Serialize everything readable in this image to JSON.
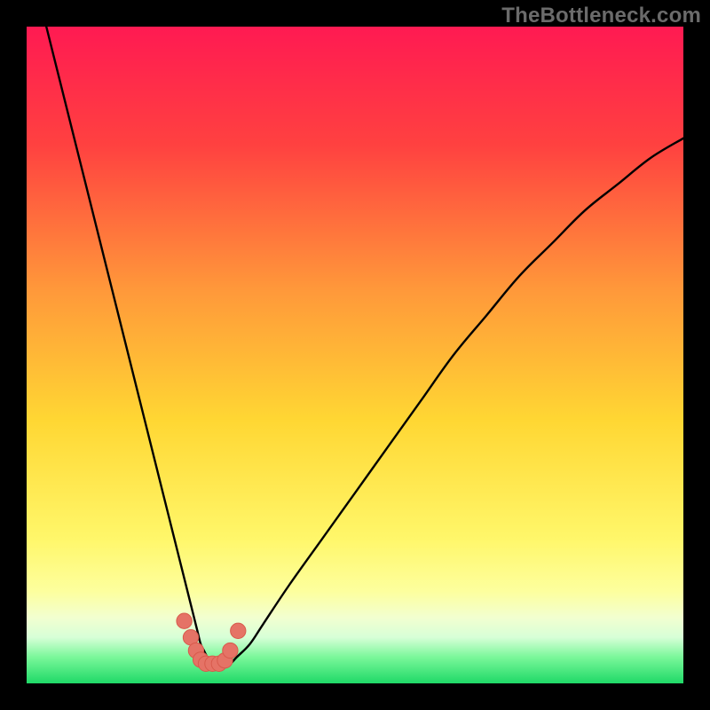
{
  "watermark": "TheBottleneck.com",
  "colors": {
    "frame": "#000000",
    "grad_top": "#ff1a52",
    "grad_mid1": "#ff7a33",
    "grad_mid2": "#ffd633",
    "grad_low": "#fffb8a",
    "grad_pale": "#f6ffe0",
    "grad_green": "#28e46d",
    "curve": "#000000",
    "marker_fill": "#e57366",
    "marker_stroke": "#d85a4c"
  },
  "chart_data": {
    "type": "line",
    "title": "",
    "xlabel": "",
    "ylabel": "",
    "xlim": [
      0,
      100
    ],
    "ylim": [
      0,
      100
    ],
    "series": [
      {
        "name": "bottleneck-curve",
        "x": [
          3,
          5,
          7,
          9,
          11,
          13,
          15,
          17,
          19,
          21,
          22,
          23,
          24,
          25,
          25.5,
          26,
          26.5,
          27,
          27.5,
          28,
          28.5,
          29,
          30,
          31,
          32,
          34,
          36,
          40,
          45,
          50,
          55,
          60,
          65,
          70,
          75,
          80,
          85,
          90,
          95,
          100
        ],
        "y": [
          100,
          92,
          84,
          76,
          68,
          60,
          52,
          44,
          36,
          28,
          24,
          20,
          16,
          12,
          10,
          8,
          6,
          5,
          4,
          3.2,
          2.8,
          2.8,
          2.8,
          3,
          4,
          6,
          9,
          15,
          22,
          29,
          36,
          43,
          50,
          56,
          62,
          67,
          72,
          76,
          80,
          83
        ]
      }
    ],
    "markers": [
      {
        "x": 24.0,
        "y": 9.5,
        "r": 1.3
      },
      {
        "x": 25.0,
        "y": 7.0,
        "r": 1.3
      },
      {
        "x": 25.8,
        "y": 5.0,
        "r": 1.3
      },
      {
        "x": 26.5,
        "y": 3.6,
        "r": 1.3
      },
      {
        "x": 27.3,
        "y": 3.0,
        "r": 1.3
      },
      {
        "x": 28.3,
        "y": 3.0,
        "r": 1.3
      },
      {
        "x": 29.3,
        "y": 3.0,
        "r": 1.3
      },
      {
        "x": 30.2,
        "y": 3.5,
        "r": 1.3
      },
      {
        "x": 31.0,
        "y": 5.0,
        "r": 1.3
      },
      {
        "x": 32.2,
        "y": 8.0,
        "r": 1.3
      }
    ],
    "gradient_stops": [
      {
        "offset": 0,
        "color": "#ff1a52"
      },
      {
        "offset": 18,
        "color": "#ff4140"
      },
      {
        "offset": 40,
        "color": "#ff983a"
      },
      {
        "offset": 60,
        "color": "#ffd733"
      },
      {
        "offset": 78,
        "color": "#fff76a"
      },
      {
        "offset": 86,
        "color": "#fdff9e"
      },
      {
        "offset": 90,
        "color": "#f2ffd0"
      },
      {
        "offset": 93,
        "color": "#d7ffd7"
      },
      {
        "offset": 96,
        "color": "#7af79a"
      },
      {
        "offset": 100,
        "color": "#1fd967"
      }
    ]
  }
}
